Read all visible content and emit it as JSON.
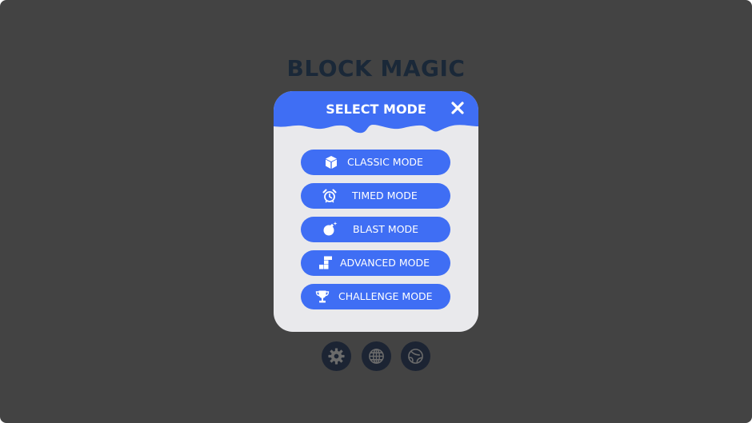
{
  "game": {
    "title": "BLOCK MAGIC"
  },
  "modal": {
    "title": "SELECT MODE",
    "close_glyph": "✕",
    "colors": {
      "header": "#3f6ef4",
      "body": "#e9e9ec",
      "button": "#3f6ef4",
      "button_text": "#ffffff"
    },
    "modes": [
      {
        "label": "CLASSIC MODE",
        "icon": "cube-icon"
      },
      {
        "label": "TIMED MODE",
        "icon": "alarm-clock-icon"
      },
      {
        "label": "BLAST MODE",
        "icon": "bomb-icon"
      },
      {
        "label": "ADVANCED MODE",
        "icon": "stairs-icon"
      },
      {
        "label": "CHALLENGE MODE",
        "icon": "trophy-icon"
      }
    ]
  },
  "bottom_bar": {
    "buttons": [
      {
        "name": "settings",
        "icon": "gear-icon"
      },
      {
        "name": "language",
        "icon": "globe-icon"
      },
      {
        "name": "theme",
        "icon": "planet-icon"
      }
    ],
    "color": "#1c2433"
  },
  "background": "#434343"
}
